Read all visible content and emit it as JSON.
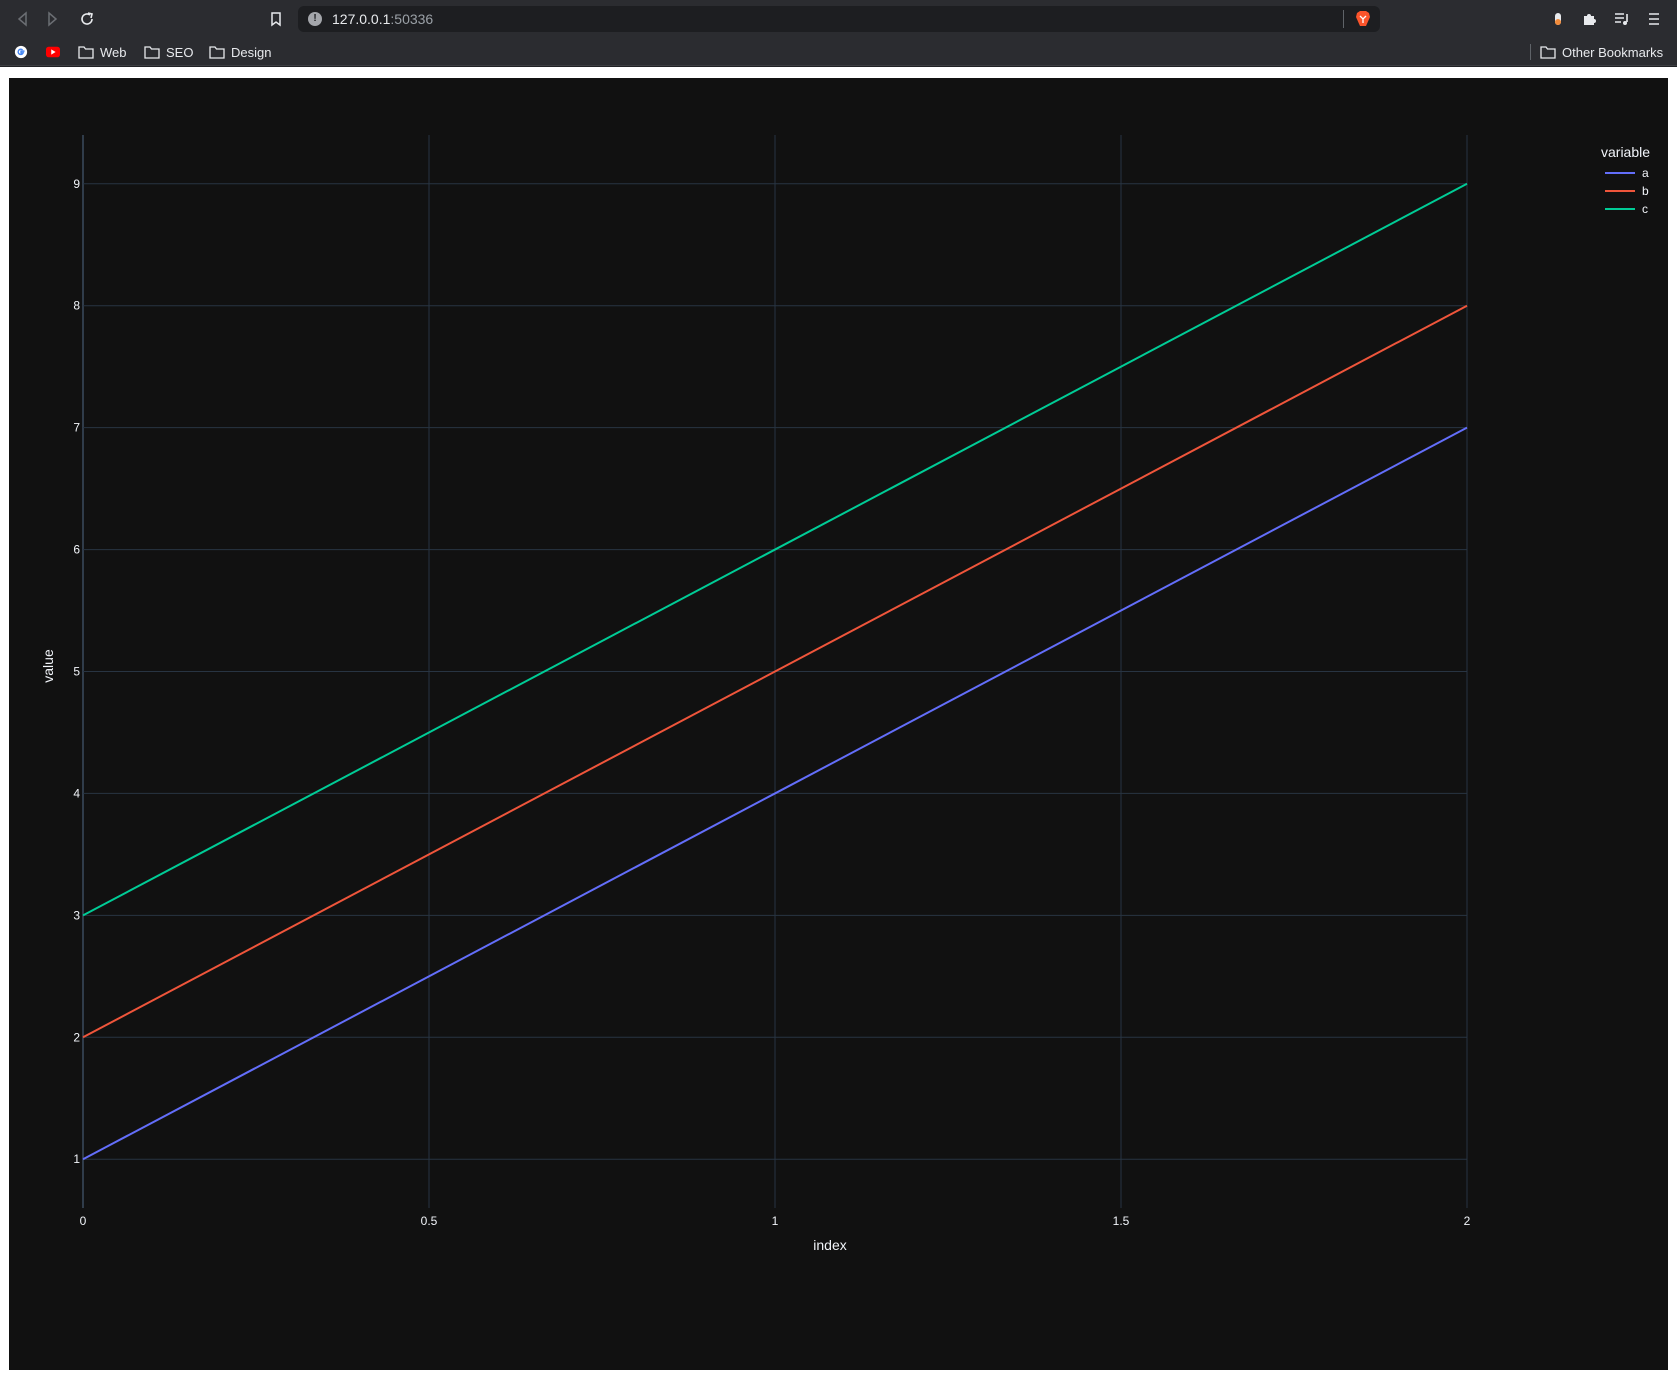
{
  "browser": {
    "address_host": "127.0.0.1",
    "address_port": ":50336",
    "bookmarks": [
      {
        "label": "Web"
      },
      {
        "label": "SEO"
      },
      {
        "label": "Design"
      }
    ],
    "other_bookmarks": "Other Bookmarks"
  },
  "colors": {
    "background": "#111111",
    "grid": "#283442",
    "series_a": "#636efa",
    "series_b": "#ef553b",
    "series_c": "#00cc96"
  },
  "chart_data": {
    "type": "line",
    "xlabel": "index",
    "ylabel": "value",
    "xlim": [
      0,
      2
    ],
    "ylim": [
      0.6,
      9.4
    ],
    "x_ticks": [
      "0",
      "0.5",
      "1",
      "1.5",
      "2"
    ],
    "x_tick_values": [
      0,
      0.5,
      1,
      1.5,
      2
    ],
    "y_ticks": [
      "1",
      "2",
      "3",
      "4",
      "5",
      "6",
      "7",
      "8",
      "9"
    ],
    "y_tick_values": [
      1,
      2,
      3,
      4,
      5,
      6,
      7,
      8,
      9
    ],
    "x": [
      0,
      1,
      2
    ],
    "legend_title": "variable",
    "legend_position": "top-right",
    "grid": true,
    "series": [
      {
        "name": "a",
        "values": [
          1,
          4,
          7
        ],
        "color": "#636efa"
      },
      {
        "name": "b",
        "values": [
          2,
          5,
          8
        ],
        "color": "#ef553b"
      },
      {
        "name": "c",
        "values": [
          3,
          6,
          9
        ],
        "color": "#00cc96"
      }
    ]
  }
}
